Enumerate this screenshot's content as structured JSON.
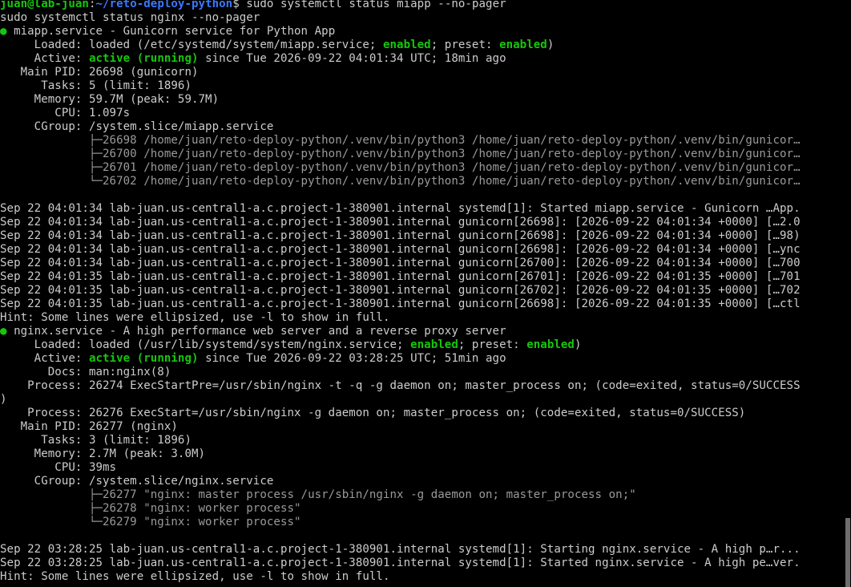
{
  "prompt": {
    "user_host": "juan@lab-juan",
    "sep": ":",
    "path": "~/reto-deploy-python",
    "symbol": "$",
    "command": " sudo systemctl status miapp --no-pager"
  },
  "line_cmd2": "sudo systemctl status nginx --no-pager",
  "miapp": {
    "dot": "●",
    "header": " miapp.service - Gunicorn service for Python App",
    "loaded_pre": "     Loaded: loaded (/etc/systemd/system/miapp.service; ",
    "enabled": "enabled",
    "loaded_mid": "; preset: ",
    "preset": "enabled",
    "loaded_post": ")",
    "active_pre": "     Active: ",
    "active_state": "active (running)",
    "active_post": " since Tue 2026-09-22 04:01:34 UTC; 18min ago",
    "main_pid": "   Main PID: 26698 (gunicorn)",
    "tasks": "      Tasks: 5 (limit: 1896)",
    "memory": "     Memory: 59.7M (peak: 59.7M)",
    "cpu": "        CPU: 1.097s",
    "cgroup": "     CGroup: /system.slice/miapp.service",
    "tree": [
      "             ├─26698 /home/juan/reto-deploy-python/.venv/bin/python3 /home/juan/reto-deploy-python/.venv/bin/gunicor…",
      "             ├─26700 /home/juan/reto-deploy-python/.venv/bin/python3 /home/juan/reto-deploy-python/.venv/bin/gunicor…",
      "             ├─26701 /home/juan/reto-deploy-python/.venv/bin/python3 /home/juan/reto-deploy-python/.venv/bin/gunicor…",
      "             └─26702 /home/juan/reto-deploy-python/.venv/bin/python3 /home/juan/reto-deploy-python/.venv/bin/gunicor…"
    ],
    "logs": [
      "Sep 22 04:01:34 lab-juan.us-central1-a.c.project-1-380901.internal systemd[1]: Started miapp.service - Gunicorn …App.",
      "Sep 22 04:01:34 lab-juan.us-central1-a.c.project-1-380901.internal gunicorn[26698]: [2026-09-22 04:01:34 +0000] […2.0",
      "Sep 22 04:01:34 lab-juan.us-central1-a.c.project-1-380901.internal gunicorn[26698]: [2026-09-22 04:01:34 +0000] […98)",
      "Sep 22 04:01:34 lab-juan.us-central1-a.c.project-1-380901.internal gunicorn[26698]: [2026-09-22 04:01:34 +0000] […ync",
      "Sep 22 04:01:34 lab-juan.us-central1-a.c.project-1-380901.internal gunicorn[26700]: [2026-09-22 04:01:34 +0000] […700",
      "Sep 22 04:01:35 lab-juan.us-central1-a.c.project-1-380901.internal gunicorn[26701]: [2026-09-22 04:01:35 +0000] […701",
      "Sep 22 04:01:35 lab-juan.us-central1-a.c.project-1-380901.internal gunicorn[26702]: [2026-09-22 04:01:35 +0000] […702",
      "Sep 22 04:01:35 lab-juan.us-central1-a.c.project-1-380901.internal gunicorn[26698]: [2026-09-22 04:01:35 +0000] […ctl"
    ],
    "hint": "Hint: Some lines were ellipsized, use -l to show in full."
  },
  "nginx": {
    "dot": "●",
    "header": " nginx.service - A high performance web server and a reverse proxy server",
    "loaded_pre": "     Loaded: loaded (/usr/lib/systemd/system/nginx.service; ",
    "enabled": "enabled",
    "loaded_mid": "; preset: ",
    "preset": "enabled",
    "loaded_post": ")",
    "active_pre": "     Active: ",
    "active_state": "active (running)",
    "active_post": " since Tue 2026-09-22 03:28:25 UTC; 51min ago",
    "docs": "       Docs: man:nginx(8)",
    "process1": "    Process: 26274 ExecStartPre=/usr/sbin/nginx -t -q -g daemon on; master_process on; (code=exited, status=0/SUCCESS",
    "process1_wrap": ")",
    "process2": "    Process: 26276 ExecStart=/usr/sbin/nginx -g daemon on; master_process on; (code=exited, status=0/SUCCESS)",
    "main_pid": "   Main PID: 26277 (nginx)",
    "tasks": "      Tasks: 3 (limit: 1896)",
    "memory": "     Memory: 2.7M (peak: 3.0M)",
    "cpu": "        CPU: 39ms",
    "cgroup": "     CGroup: /system.slice/nginx.service",
    "tree": [
      "             ├─26277 \"nginx: master process /usr/sbin/nginx -g daemon on; master_process on;\"",
      "             ├─26278 \"nginx: worker process\"",
      "             └─26279 \"nginx: worker process\""
    ],
    "logs": [
      "Sep 22 03:28:25 lab-juan.us-central1-a.c.project-1-380901.internal systemd[1]: Starting nginx.service - A high p…r...",
      "Sep 22 03:28:25 lab-juan.us-central1-a.c.project-1-380901.internal systemd[1]: Started nginx.service - A high pe…ver."
    ],
    "hint": "Hint: Some lines were ellipsized, use -l to show in full."
  },
  "colors": {
    "background": "#000000",
    "text": "#cccccc",
    "green": "#16c60c",
    "path_blue": "#3b78ff"
  }
}
